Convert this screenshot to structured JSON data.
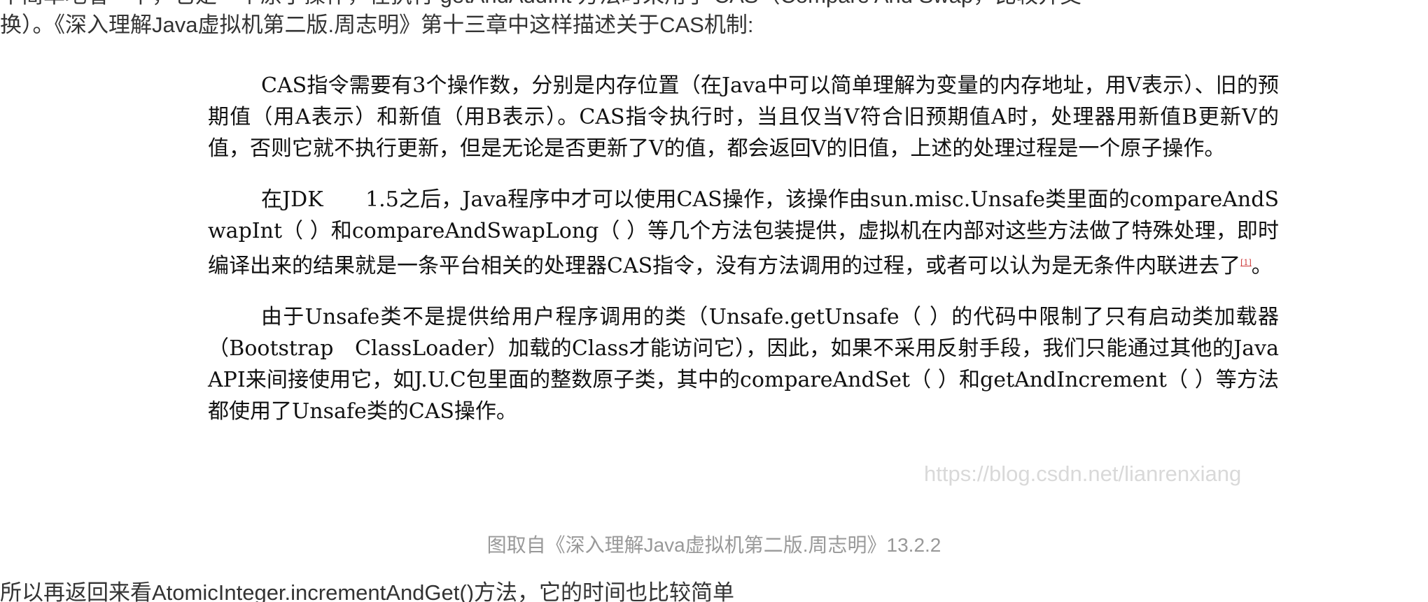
{
  "article": {
    "top_line_partial": "中简单地看一下，它是一个原子操作，在执行 getAndAddInt 方法时采用了 CAS（Compare And Swap，比较并交",
    "intro_line": "换）。《深入理解Java虚拟机第二版.周志明》第十三章中这样描述关于CAS机制:",
    "figure": {
      "paragraphs": [
        "CAS指令需要有3个操作数，分别是内存位置（在Java中可以简单理解为变量的内存地址，用V表示）、旧的预期值（用A表示）和新值（用B表示）。CAS指令执行时，当且仅当V符合旧预期值A时，处理器用新值B更新V的值，否则它就不执行更新，但是无论是否更新了V的值，都会返回V的旧值，上述的处理过程是一个原子操作。",
        "在JDK　　1.5之后，Java程序中才可以使用CAS操作，该操作由sun.misc.Unsafe类里面的compareAndSwapInt（ ）和compareAndSwapLong（ ）等几个方法包装提供，虚拟机在内部对这些方法做了特殊处理，即时编译出来的结果就是一条平台相关的处理器CAS指令，没有方法调用的过程，或者可以认为是无条件内联进去了",
        "由于Unsafe类不是提供给用户程序调用的类（Unsafe.getUnsafe（ ）的代码中限制了只有启动类加载器（Bootstrap　ClassLoader）加载的Class才能访问它），因此，如果不采用反射手段，我们只能通过其他的Java　　API来间接使用它，如J.U.C包里面的整数原子类，其中的compareAndSet（ ）和getAndIncrement（ ）等方法都使用了Unsafe类的CAS操作。"
      ],
      "footnote_mark": "[1]",
      "footnote_tail": "。",
      "watermark": "https://blog.csdn.net/lianrenxiang"
    },
    "caption": "图取自《深入理解Java虚拟机第二版.周志明》13.2.2",
    "outro_line": "所以再返回来看AtomicInteger.incrementAndGet()方法，它的时间也比较简单"
  }
}
